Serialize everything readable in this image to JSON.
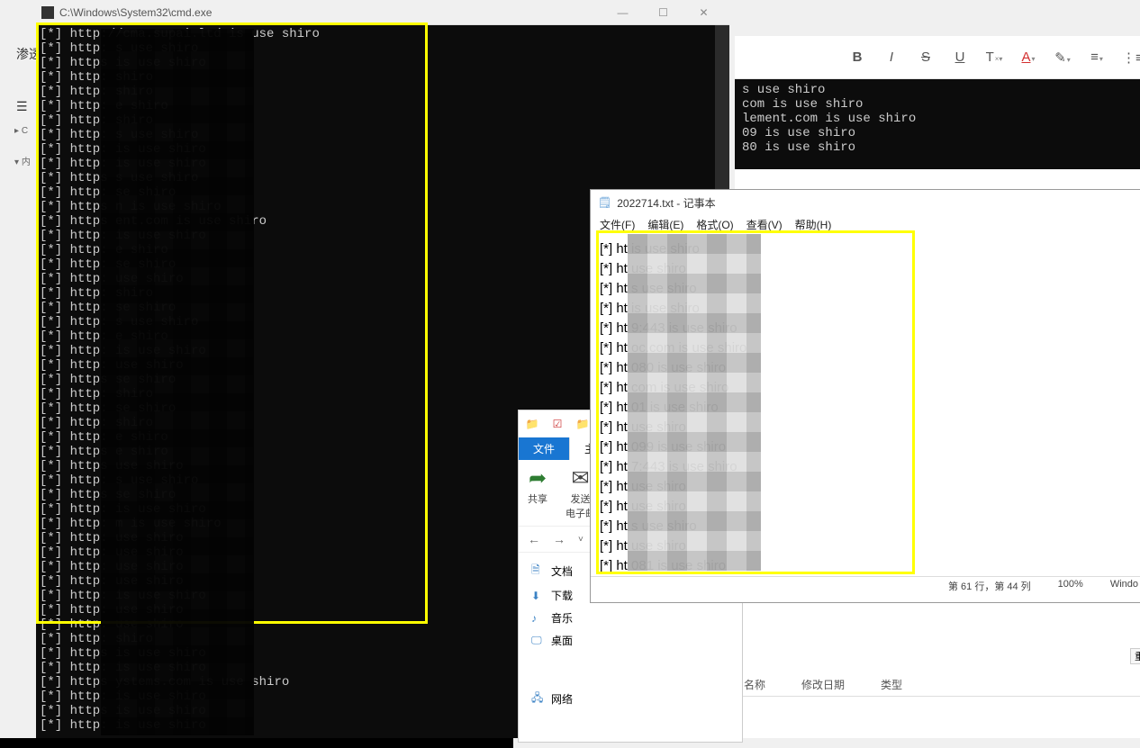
{
  "left_bg": {
    "title": "渗透",
    "tree1": "C",
    "tree2": "内"
  },
  "cmd": {
    "title_path": "C:\\Windows\\System32\\cmd.exe",
    "lines": [
      "[*] http://cma.supai.ltd is use shiro",
      "[*] http:                    s use shiro",
      "[*] https                    is use shiro",
      "[*] http:                    shiro",
      "[*] http:                    shiro",
      "[*] http:                   e shiro",
      "[*] http:                    shiro",
      "[*] http:                   s use shiro",
      "[*] http:                    is use shiro",
      "[*] http:                   is use shiro",
      "[*] https                   s use shiro",
      "[*] http:                   se shiro",
      "[*] https                   n is use shiro",
      "[*] https                   ent.com is use shiro",
      "[*] http:                   is use shiro",
      "[*] http:                   e shiro",
      "[*] http:                   se shiro",
      "[*] http:                   use shiro",
      "[*] http:                    shiro",
      "[*] http:                   se shiro",
      "[*] http:                   s use shiro",
      "[*] http:                   e shiro",
      "[*] http:                   is use shiro",
      "[*] http:                    use shiro",
      "[*] https                   se shiro",
      "[*] http:                    shiro",
      "[*] http:                   se shiro",
      "[*] http:                    shiro",
      "[*] http:                   e shiro",
      "[*] https                   e shiro",
      "[*] https                   use shiro",
      "[*] http:                   s use shiro",
      "[*] https                   se shiro",
      "[*] http:                    is use shiro",
      "[*] http:                   m is use shiro",
      "[*] http:                   use shiro",
      "[*] http:                   use shiro",
      "[*] http:                    use shiro",
      "[*] http:                    use shiro",
      "[*] http:                   is use shiro",
      "[*] http:                   use shiro",
      "[*] http:                    use shiro",
      "[*] http:                    shiro",
      "[*] https                   is use shiro",
      "[*] http:                    is use shiro",
      "[*] https                   ystems.com is use shiro",
      "[*] http:                   is use shiro",
      "[*] https                    is use shiro",
      "[*] http:                   is use shiro"
    ]
  },
  "editor": {
    "code_lines": [
      "s use shiro",
      "com is use shiro",
      "lement.com is use shiro",
      "09 is use shiro",
      "80 is use shiro"
    ],
    "col_name": "名称",
    "col_date": "修改日期",
    "col_type": "类型",
    "resend": "重"
  },
  "explorer": {
    "tab_file": "文件",
    "tab_home": "主",
    "share": "共享",
    "email": "发送\n电子邮",
    "nav_back": "←",
    "nav_fwd": "→",
    "nav_up": "↑",
    "side_docs": "文档",
    "side_downloads": "下载",
    "side_music": "音乐",
    "side_desktop": "桌面",
    "side_network": "网络"
  },
  "notepad": {
    "title": "2022714.txt - 记事本",
    "menu_file": "文件(F)",
    "menu_edit": "编辑(E)",
    "menu_format": "格式(O)",
    "menu_view": "查看(V)",
    "menu_help": "帮助(H)",
    "lines": [
      "[*] ht                      is use shiro",
      "[*] ht                      use shiro",
      "[*] ht                     s use shiro",
      "[*] ht                      is use shiro",
      "[*] ht                     9:443 is use shiro",
      "[*] ht                     oc.com is use shiro",
      "[*] ht                     080 is use shiro",
      "[*] ht                     com is use shiro",
      "[*] ht                     01 is use shiro",
      "[*] ht                     use shiro",
      "[*] ht                     099 is use shiro",
      "[*] ht                     7:443 is use shiro",
      "[*] ht                     use shiro",
      "[*] ht                     use shiro",
      "[*] ht                     s use shiro",
      "[*] ht                     use shiro",
      "[*] ht                     081 is use shiro"
    ],
    "status_pos": "第 61 行，第 44 列",
    "status_zoom": "100%",
    "status_enc": "Windo"
  }
}
